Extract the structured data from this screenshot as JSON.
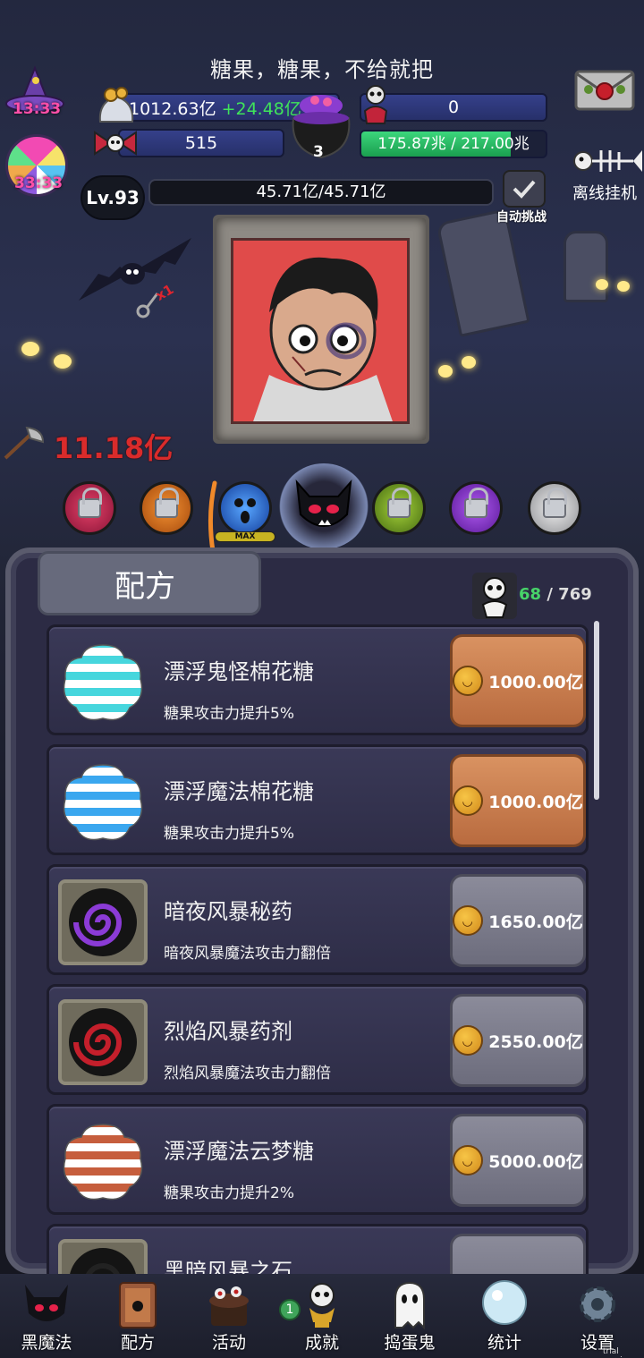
{
  "header": {
    "title": "糖果，糖果，不给就把",
    "hat_timer": "13:33",
    "candy_timer": "33:33",
    "candy_amount": "1012.63亿",
    "candy_delta": "+24.48亿",
    "skull_count": "0",
    "bow_count": "515",
    "cauldron_count": "3",
    "green_bar_text": "175.87兆 / 217.00兆",
    "green_bar_fraction": 0.81,
    "offline_label": "离线挂机",
    "level": "Lv.93",
    "hp_text": "45.71亿/45.71亿",
    "auto_label": "自动挑战"
  },
  "scene": {
    "damage": "11.18亿",
    "key_label": "x1",
    "max_label": "MAX"
  },
  "panel": {
    "title": "配方",
    "count_current": "68",
    "count_total": "/ 769",
    "recipes": [
      {
        "name": "漂浮鬼怪棉花糖",
        "desc": "糖果攻击力提升5%",
        "price": "1000.00亿",
        "style": "orange"
      },
      {
        "name": "漂浮魔法棉花糖",
        "desc": "糖果攻击力提升5%",
        "price": "1000.00亿",
        "style": "orange"
      },
      {
        "name": "暗夜风暴秘药",
        "desc": "暗夜风暴魔法攻击力翻倍",
        "price": "1650.00亿",
        "style": "grey"
      },
      {
        "name": "烈焰风暴药剂",
        "desc": "烈焰风暴魔法攻击力翻倍",
        "price": "2550.00亿",
        "style": "grey"
      },
      {
        "name": "漂浮魔法云梦糖",
        "desc": "糖果攻击力提升2%",
        "price": "5000.00亿",
        "style": "grey"
      },
      {
        "name": "黑暗风暴之石",
        "desc": "",
        "price": "",
        "style": "grey"
      }
    ]
  },
  "nav": {
    "items": [
      "黑魔法",
      "配方",
      "活动",
      "成就",
      "捣蛋鬼",
      "统计",
      "设置"
    ],
    "achievement_badge": "1"
  },
  "footer": {
    "trial": "trial version"
  },
  "colors": {
    "accent_green": "#3fe35a",
    "damage_red": "#d92b2b",
    "panel_bg": "#2c2b44"
  }
}
